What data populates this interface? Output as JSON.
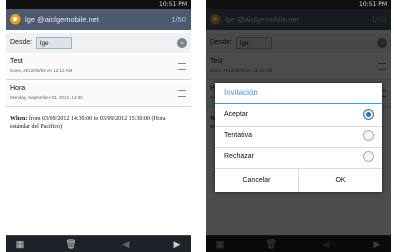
{
  "status": {
    "time": "10:51 PM"
  },
  "header": {
    "account": "lge @aiclgemobile.net",
    "count": "1/50"
  },
  "from": {
    "label": "Desde:",
    "chip": "lge"
  },
  "items": [
    {
      "title": "Test",
      "subtitle": "lunes, 2012/09/03 en 12:12 AM"
    },
    {
      "title": "Hora",
      "subtitle": "Monday, September 03, 2012, 14:30"
    }
  ],
  "body": {
    "when_label": "When:",
    "when_text": " from 03/09/2012 14:30:00 to 03/09/2012 15:30:00 (Hora estándar del Pacífico)"
  },
  "dialog": {
    "title": "Invitación",
    "options": [
      {
        "label": "Aceptar",
        "selected": true
      },
      {
        "label": "Tentativa",
        "selected": false
      },
      {
        "label": "Rechazar",
        "selected": false
      }
    ],
    "cancel": "Cancelar",
    "ok": "OK"
  },
  "icons": {
    "expand": "chevron-down-icon",
    "delete": "trash-icon",
    "prev": "arrow-left-icon",
    "next": "arrow-right-icon",
    "menu": "grid-icon"
  }
}
